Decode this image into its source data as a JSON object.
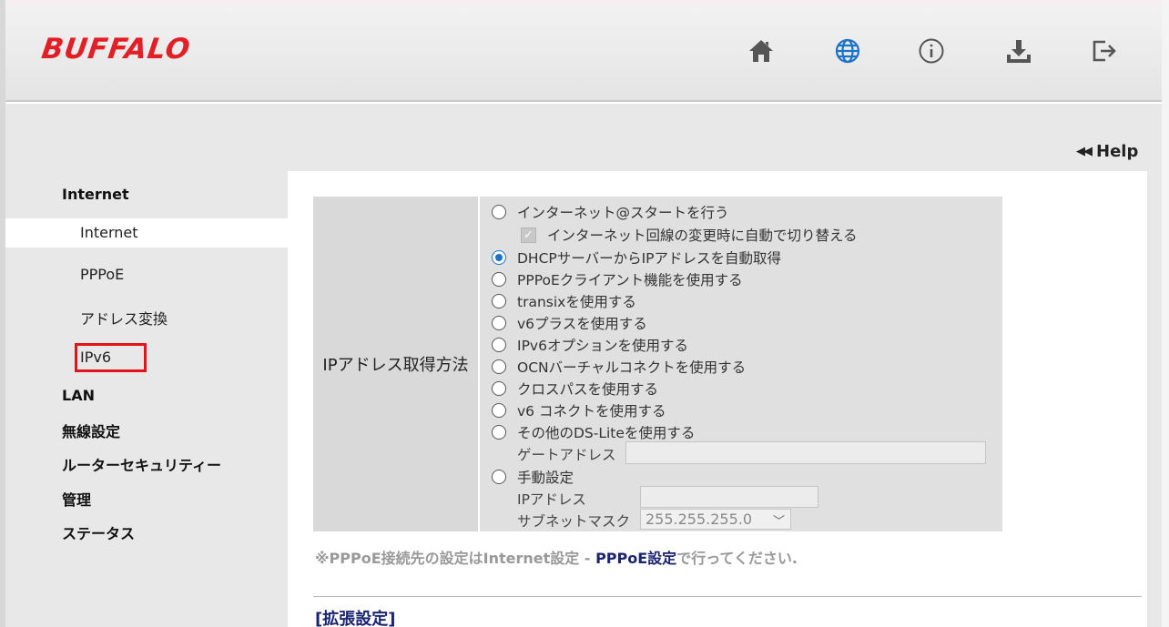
{
  "brand": {
    "logo_text": "BUFFALO",
    "color": "#e21f26"
  },
  "header": {
    "icons": [
      "home-icon",
      "globe-icon",
      "info-icon",
      "download-icon",
      "logout-icon"
    ],
    "active_icon": "globe-icon",
    "active_color": "#1a73c8"
  },
  "help": {
    "label": "Help"
  },
  "sidebar": {
    "categories": {
      "internet": "Internet",
      "lan": "LAN",
      "wireless": "無線設定",
      "security": "ルーターセキュリティー",
      "admin": "管理",
      "status": "ステータス"
    },
    "internet_items": {
      "internet": "Internet",
      "pppoe": "PPPoE",
      "nat": "アドレス変換",
      "ipv6": "IPv6"
    },
    "active_item": "Internet",
    "highlighted_item": "IPv6"
  },
  "form": {
    "label": "IPアドレス取得方法",
    "options": {
      "internet_start": "インターネット@スタートを行う",
      "auto_switch": "インターネット回線の変更時に自動で切り替える",
      "dhcp": "DHCPサーバーからIPアドレスを自動取得",
      "pppoe_client": "PPPoEクライアント機能を使用する",
      "transix": "transixを使用する",
      "v6plus": "v6プラスを使用する",
      "ipv6_option": "IPv6オプションを使用する",
      "ocn": "OCNバーチャルコネクトを使用する",
      "crosspath": "クロスパスを使用する",
      "v6connect": "v6 コネクトを使用する",
      "ds_lite": "その他のDS-Liteを使用する",
      "manual": "手動設定"
    },
    "selected_option": "DHCPサーバーからIPアドレスを自動取得",
    "gateway_label": "ゲートアドレス",
    "gateway_value": "",
    "ip_label": "IPアドレス",
    "ip_value": "",
    "subnet_label": "サブネットマスク",
    "subnet_value": "255.255.255.0"
  },
  "note": {
    "prefix": "※PPPoE接続先の設定はInternet設定 - ",
    "link": "PPPoE設定",
    "suffix": "で行ってください."
  },
  "extended": {
    "title": "[拡張設定]"
  }
}
